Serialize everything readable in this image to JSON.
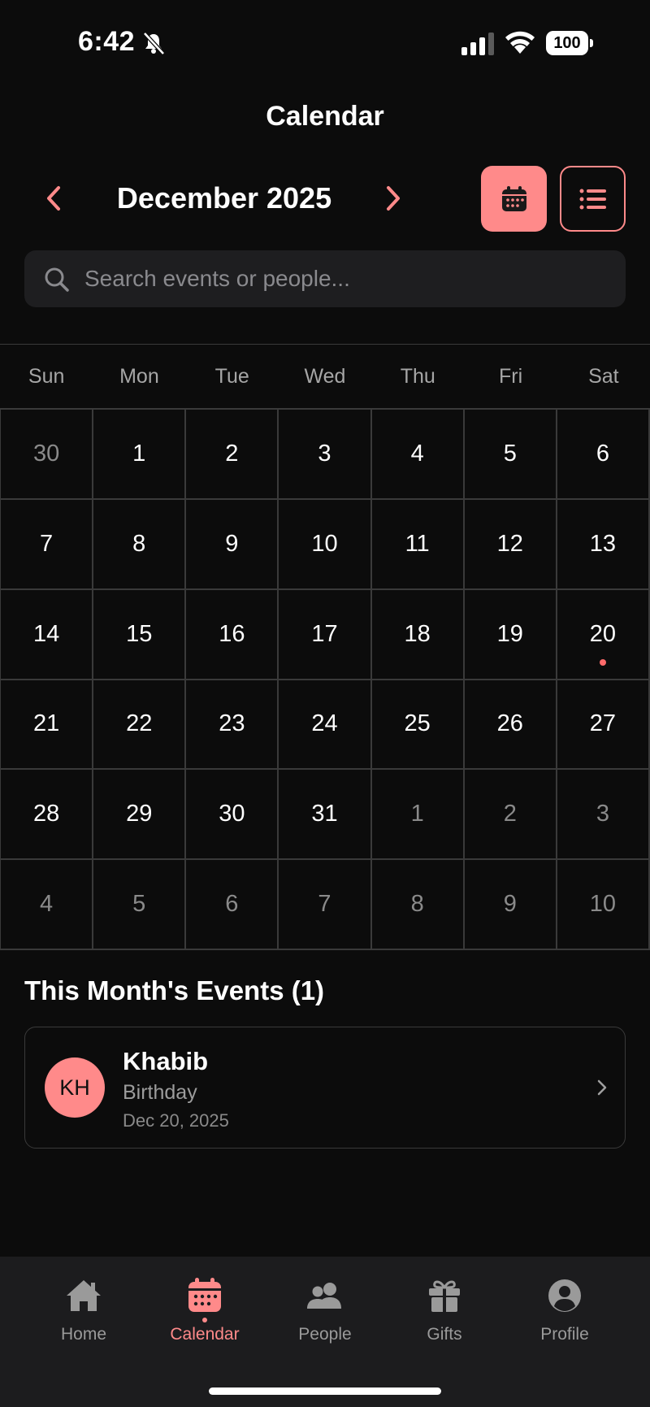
{
  "status_bar": {
    "time": "6:42",
    "battery": "100"
  },
  "header": {
    "title": "Calendar"
  },
  "month_nav": {
    "label": "December 2025"
  },
  "search": {
    "placeholder": "Search events or people..."
  },
  "weekdays": [
    "Sun",
    "Mon",
    "Tue",
    "Wed",
    "Thu",
    "Fri",
    "Sat"
  ],
  "days": [
    {
      "num": "30",
      "current": false
    },
    {
      "num": "1",
      "current": true
    },
    {
      "num": "2",
      "current": true
    },
    {
      "num": "3",
      "current": true
    },
    {
      "num": "4",
      "current": true
    },
    {
      "num": "5",
      "current": true
    },
    {
      "num": "6",
      "current": true
    },
    {
      "num": "7",
      "current": true
    },
    {
      "num": "8",
      "current": true
    },
    {
      "num": "9",
      "current": true
    },
    {
      "num": "10",
      "current": true
    },
    {
      "num": "11",
      "current": true
    },
    {
      "num": "12",
      "current": true
    },
    {
      "num": "13",
      "current": true
    },
    {
      "num": "14",
      "current": true
    },
    {
      "num": "15",
      "current": true
    },
    {
      "num": "16",
      "current": true
    },
    {
      "num": "17",
      "current": true
    },
    {
      "num": "18",
      "current": true
    },
    {
      "num": "19",
      "current": true
    },
    {
      "num": "20",
      "current": true,
      "event": true
    },
    {
      "num": "21",
      "current": true
    },
    {
      "num": "22",
      "current": true
    },
    {
      "num": "23",
      "current": true
    },
    {
      "num": "24",
      "current": true
    },
    {
      "num": "25",
      "current": true
    },
    {
      "num": "26",
      "current": true
    },
    {
      "num": "27",
      "current": true
    },
    {
      "num": "28",
      "current": true
    },
    {
      "num": "29",
      "current": true
    },
    {
      "num": "30",
      "current": true
    },
    {
      "num": "31",
      "current": true
    },
    {
      "num": "1",
      "current": false
    },
    {
      "num": "2",
      "current": false
    },
    {
      "num": "3",
      "current": false
    },
    {
      "num": "4",
      "current": false
    },
    {
      "num": "5",
      "current": false
    },
    {
      "num": "6",
      "current": false
    },
    {
      "num": "7",
      "current": false
    },
    {
      "num": "8",
      "current": false
    },
    {
      "num": "9",
      "current": false
    },
    {
      "num": "10",
      "current": false
    }
  ],
  "events_section": {
    "title": "This Month's Events (1)",
    "events": [
      {
        "initials": "KH",
        "name": "Khabib",
        "type": "Birthday",
        "date": "Dec 20, 2025"
      }
    ]
  },
  "tabs": [
    {
      "label": "Home",
      "icon": "home-icon",
      "active": false
    },
    {
      "label": "Calendar",
      "icon": "calendar-icon",
      "active": true
    },
    {
      "label": "People",
      "icon": "people-icon",
      "active": false
    },
    {
      "label": "Gifts",
      "icon": "gift-icon",
      "active": false
    },
    {
      "label": "Profile",
      "icon": "profile-icon",
      "active": false
    }
  ],
  "colors": {
    "accent": "#ff8a8a",
    "background": "#0c0c0c",
    "tab_bar": "#1c1c1e",
    "event_dot": "#ff6b6b"
  }
}
